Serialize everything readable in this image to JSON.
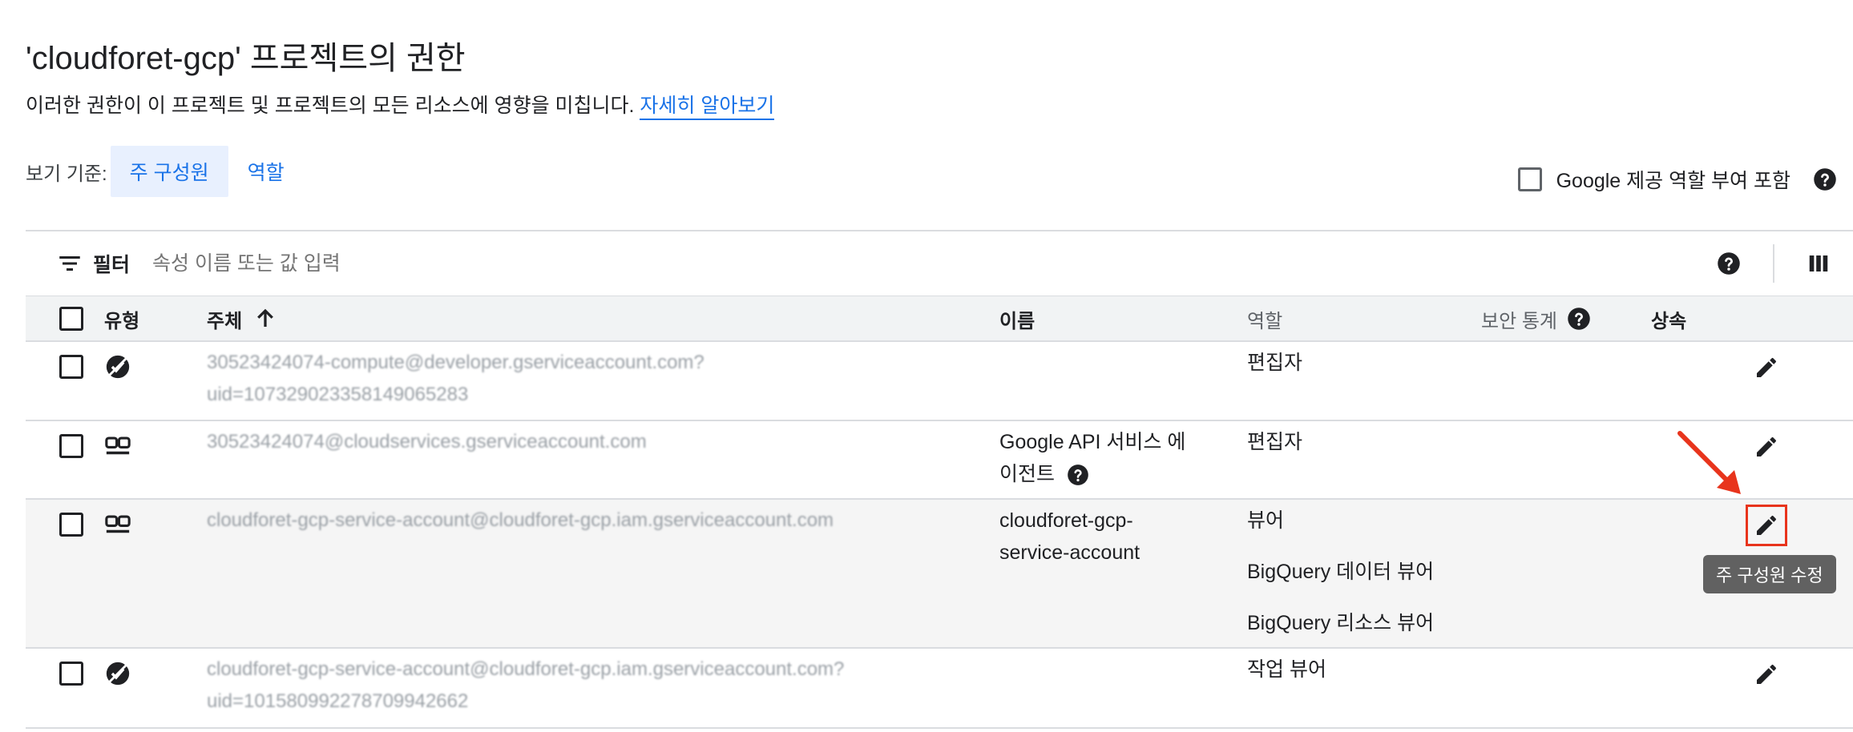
{
  "page": {
    "title": "'cloudforet-gcp' 프로젝트의 권한",
    "description": "이러한 권한이 이 프로젝트 및 프로젝트의 모든 리소스에 영향을 미칩니다.",
    "learn_more": "자세히 알아보기"
  },
  "view_by": {
    "label": "보기 기준:",
    "options": [
      "주 구성원",
      "역할"
    ],
    "selected": "주 구성원"
  },
  "include_google": {
    "label": "Google 제공 역할 부여 포함",
    "checked": false
  },
  "filter": {
    "label": "필터",
    "placeholder": "속성 이름 또는 값 입력"
  },
  "table": {
    "headers": {
      "type": "유형",
      "principal": "주체",
      "name": "이름",
      "role": "역할",
      "security": "보안 통계",
      "inherit": "상속"
    },
    "sort": {
      "column": "주체",
      "direction": "ascending"
    },
    "rows": [
      {
        "type_icon": "service-agent-icon",
        "principal_line1": "30523424074-compute@developer.gserviceaccount.com?",
        "principal_line2": "uid=107329023358149065283",
        "name_line1": "",
        "name_line2": "",
        "roles": [
          "편집자"
        ]
      },
      {
        "type_icon": "service-account-icon",
        "principal_line1": "30523424074@cloudservices.gserviceaccount.com",
        "principal_line2": "",
        "name_line1": "Google API 서비스 에",
        "name_line2": "이전트",
        "roles": [
          "편집자"
        ]
      },
      {
        "type_icon": "service-account-icon",
        "principal_line1": "cloudforet-gcp-service-account@cloudforet-gcp.iam.gserviceaccount.com",
        "principal_line2": "",
        "name_line1": "cloudforet-gcp-",
        "name_line2": "service-account",
        "roles": [
          "뷰어",
          "BigQuery 데이터 뷰어",
          "BigQuery 리소스 뷰어"
        ]
      },
      {
        "type_icon": "service-agent-icon",
        "principal_line1": "cloudforet-gcp-service-account@cloudforet-gcp.iam.gserviceaccount.com?",
        "principal_line2": "uid=101580992278709942662",
        "name_line1": "",
        "name_line2": "",
        "roles": [
          "작업 뷰어"
        ]
      }
    ]
  },
  "tooltip": "주 구성원 수정",
  "colors": {
    "accent": "#1a73e8",
    "selected_bg": "#e8f0fe",
    "highlight": "#e8341c",
    "tooltip_bg": "#616161"
  }
}
